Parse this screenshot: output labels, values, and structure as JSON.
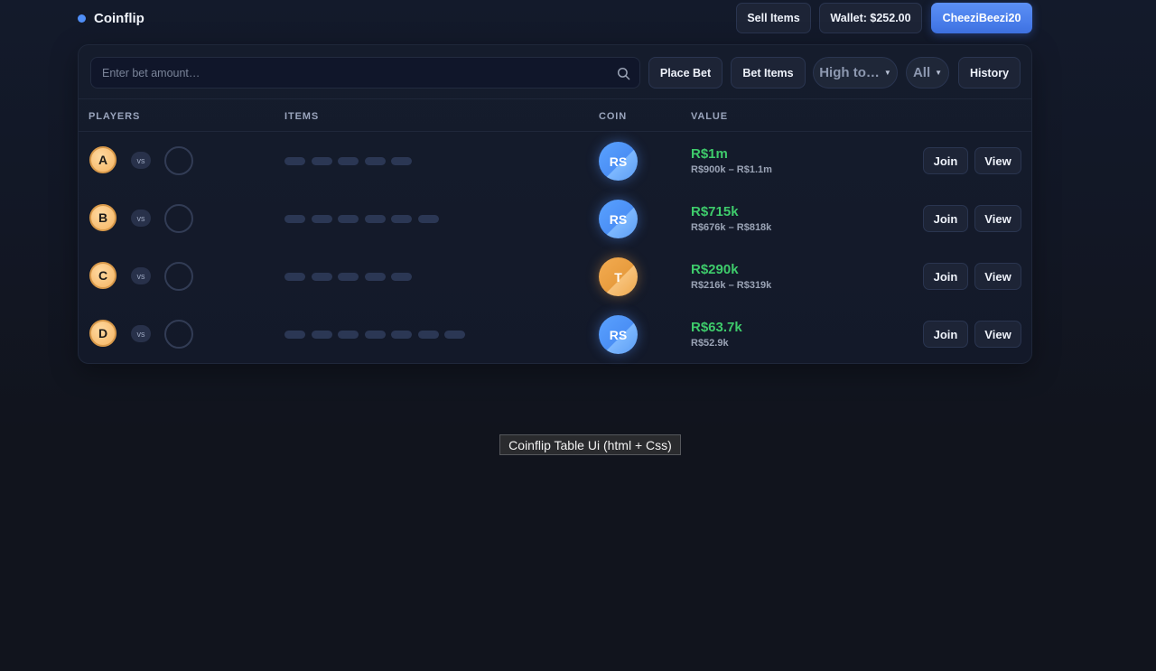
{
  "header": {
    "title": "Coinflip",
    "sell_items_label": "Sell Items",
    "wallet_label": "Wallet: $252.00",
    "username": "CheeziBeezi20"
  },
  "toolbar": {
    "search_placeholder": "Enter bet amount…",
    "search_value": "",
    "place_bet_label": "Place Bet",
    "bet_items_label": "Bet Items",
    "sort_label": "High to…",
    "filter_label": "All",
    "history_label": "History"
  },
  "table": {
    "columns": {
      "players": "PLAYERS",
      "items": "ITEMS",
      "coin": "COIN",
      "value": "VALUE"
    },
    "vs_label": "vs",
    "rows": [
      {
        "player": "A",
        "item_count": 5,
        "coin": "RS",
        "coin_type": "rs",
        "value": "R$1m",
        "range": "R$900k – R$1.1m",
        "join_label": "Join",
        "view_label": "View"
      },
      {
        "player": "B",
        "item_count": 6,
        "coin": "RS",
        "coin_type": "rs",
        "value": "R$715k",
        "range": "R$676k – R$818k",
        "join_label": "Join",
        "view_label": "View"
      },
      {
        "player": "C",
        "item_count": 5,
        "coin": "T",
        "coin_type": "t",
        "value": "R$290k",
        "range": "R$216k – R$319k",
        "join_label": "Join",
        "view_label": "View"
      },
      {
        "player": "D",
        "item_count": 7,
        "coin": "RS",
        "coin_type": "rs",
        "value": "R$63.7k",
        "range": "R$52.9k",
        "join_label": "Join",
        "view_label": "View"
      }
    ]
  },
  "tooltip": {
    "text": "Coinflip Table Ui (html + Css)"
  },
  "colors": {
    "accent": "#4f8ef7",
    "value_green": "#3ecb6b",
    "coin_rs": "#5aa2ff",
    "coin_t": "#f3ac52",
    "player_avatar": "#f5b462"
  },
  "icons": {
    "search": "search-icon",
    "status_dot": "status-dot-icon",
    "caret": "caret-down-icon"
  }
}
